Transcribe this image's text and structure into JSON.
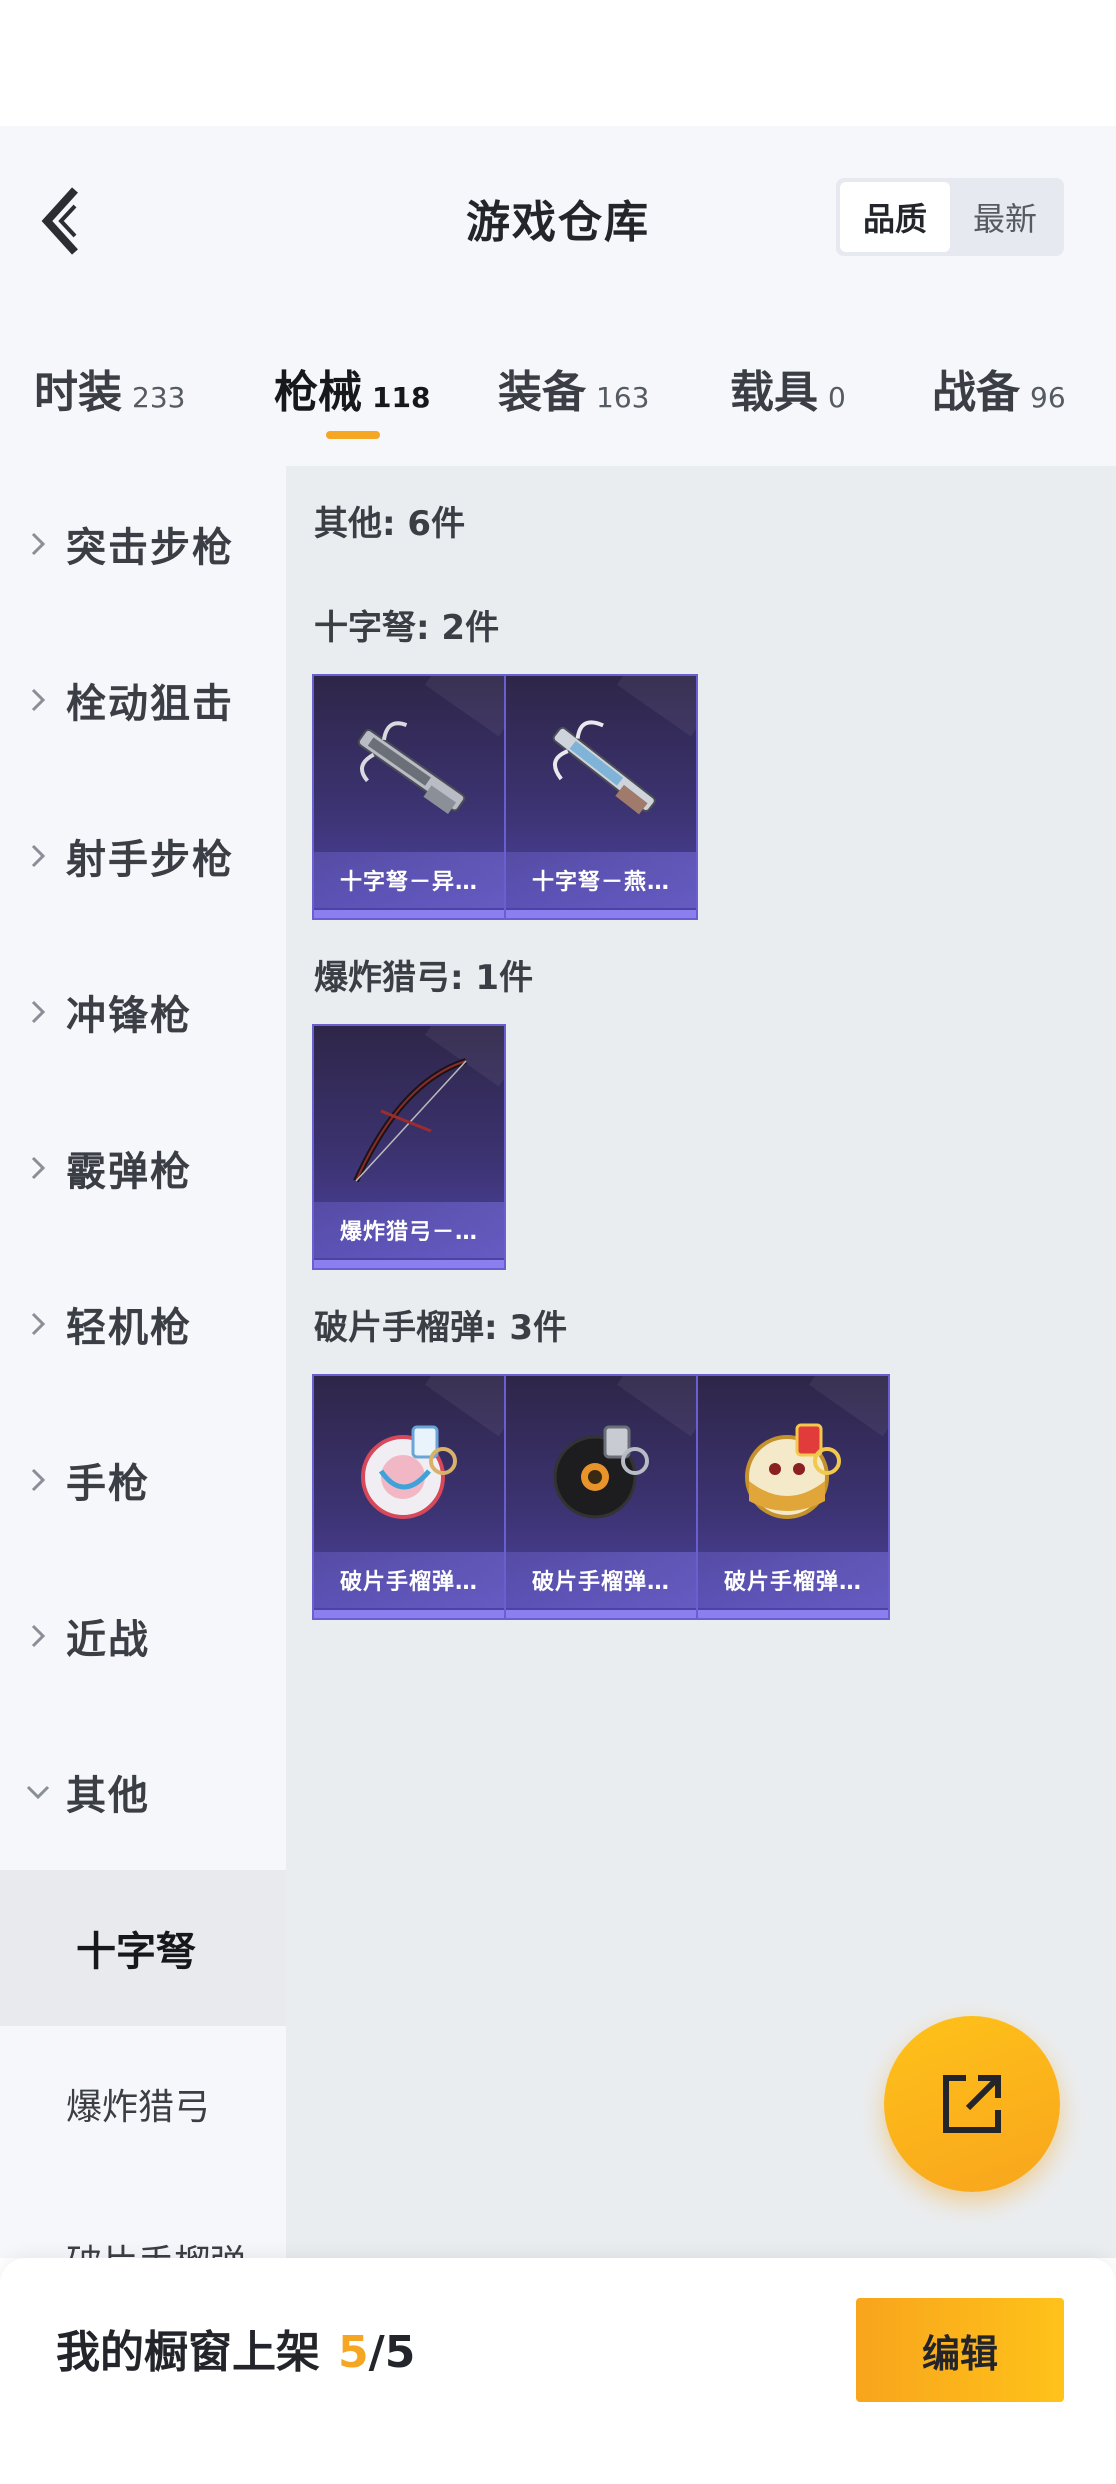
{
  "header": {
    "title": "游戏仓库",
    "sort_options": [
      "品质",
      "最新"
    ],
    "sort_selected": "品质"
  },
  "tabs": [
    {
      "label": "时装",
      "count": "233"
    },
    {
      "label": "枪械",
      "count": "118",
      "active": true
    },
    {
      "label": "装备",
      "count": "163"
    },
    {
      "label": "载具",
      "count": "0"
    },
    {
      "label": "战备",
      "count": "96"
    }
  ],
  "sidebar": {
    "categories": [
      "突击步枪",
      "栓动狙击",
      "射手步枪",
      "冲锋枪",
      "霰弹枪",
      "轻机枪",
      "手枪",
      "近战",
      "其他"
    ],
    "expanded": "其他",
    "subcategories": [
      "十字弩",
      "爆炸猎弓",
      "破片手榴弹"
    ],
    "active_sub": "十字弩"
  },
  "content": {
    "summary": "其他: 6件",
    "groups": [
      {
        "title": "十字弩: 2件",
        "items": [
          {
            "name": "十字弩－异…",
            "icon": "crossbow-icon"
          },
          {
            "name": "十字弩－燕…",
            "icon": "crossbow-icon"
          }
        ]
      },
      {
        "title": "爆炸猎弓: 1件",
        "items": [
          {
            "name": "爆炸猎弓－…",
            "icon": "bow-icon"
          }
        ]
      },
      {
        "title": "破片手榴弹: 3件",
        "items": [
          {
            "name": "破片手榴弹…",
            "icon": "grenade-icon"
          },
          {
            "name": "破片手榴弹…",
            "icon": "grenade-icon"
          },
          {
            "name": "破片手榴弹…",
            "icon": "grenade-icon"
          }
        ]
      }
    ]
  },
  "bottom": {
    "showcase_label": "我的橱窗上架",
    "showcase_count": "5",
    "showcase_sep": "/",
    "showcase_total": "5",
    "edit_label": "编辑"
  },
  "colors": {
    "accent": "#f5a623",
    "card_purple": "#3c3372",
    "page_bg": "#f5f7fb"
  }
}
